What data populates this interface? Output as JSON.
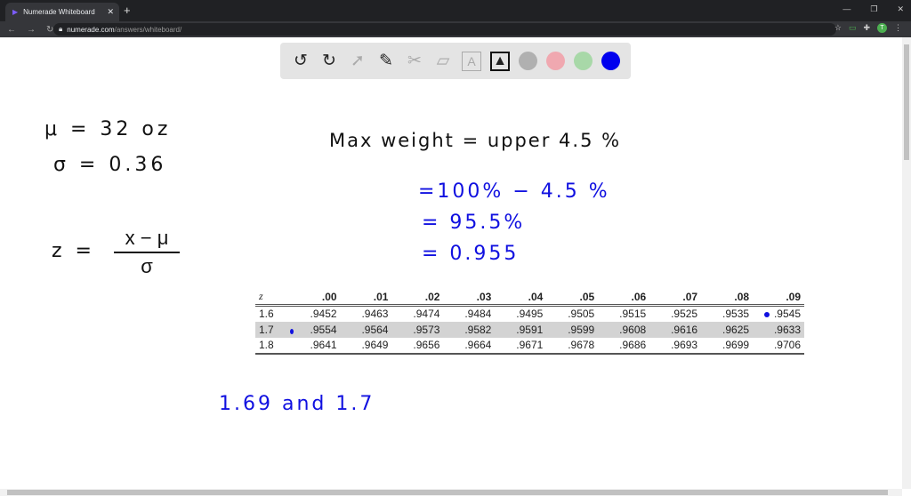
{
  "browser": {
    "tab_title": "Numerade Whiteboard",
    "url_domain": "numerade.com",
    "url_path": "/answers/whiteboard/",
    "avatar": "T"
  },
  "toolbar": {
    "colors": [
      "#b0b0b0",
      "#f0a8b0",
      "#a8d8a8",
      "#0000ee"
    ]
  },
  "notes": {
    "mu": "μ = 32 oz",
    "sigma": "σ = 0.36",
    "z_lhs": "z =",
    "z_num": "x − μ",
    "z_den": "σ",
    "max_weight": "Max weight = upper 4.5 %",
    "step1": "=100% − 4.5 %",
    "step2": "= 95.5%",
    "step3": "= 0.955",
    "answer": "1.69  and 1.7"
  },
  "z_table": {
    "headers": [
      "z",
      ".00",
      ".01",
      ".02",
      ".03",
      ".04",
      ".05",
      ".06",
      ".07",
      ".08",
      ".09"
    ],
    "rows": [
      [
        "1.6",
        ".9452",
        ".9463",
        ".9474",
        ".9484",
        ".9495",
        ".9505",
        ".9515",
        ".9525",
        ".9535",
        ".9545"
      ],
      [
        "1.7",
        ".9554",
        ".9564",
        ".9573",
        ".9582",
        ".9591",
        ".9599",
        ".9608",
        ".9616",
        ".9625",
        ".9633"
      ],
      [
        "1.8",
        ".9641",
        ".9649",
        ".9656",
        ".9664",
        ".9671",
        ".9678",
        ".9686",
        ".9693",
        ".9699",
        ".9706"
      ]
    ]
  }
}
